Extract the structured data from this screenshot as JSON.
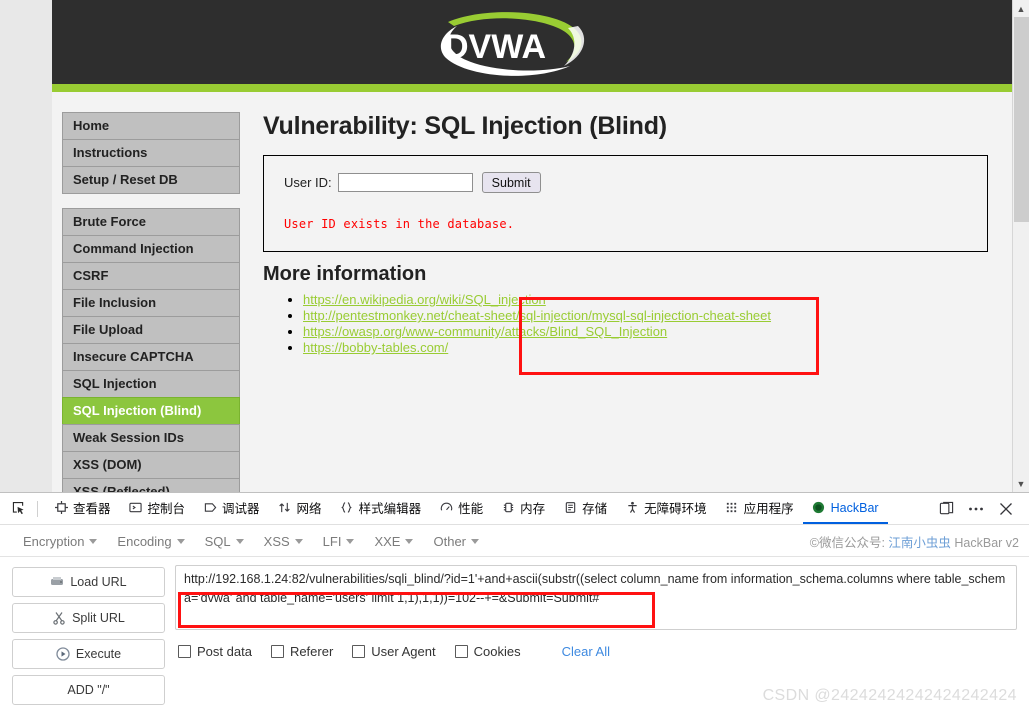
{
  "browser": {
    "scrollbar": {
      "up_icon": "chevron-up-icon",
      "down_icon": "chevron-down-icon"
    }
  },
  "dvwa": {
    "logo_text": "DVWA",
    "page_title": "Vulnerability: SQL Injection (Blind)",
    "sidebar": {
      "group1": [
        {
          "label": "Home",
          "active": false
        },
        {
          "label": "Instructions",
          "active": false
        },
        {
          "label": "Setup / Reset DB",
          "active": false
        }
      ],
      "group2": [
        {
          "label": "Brute Force",
          "active": false
        },
        {
          "label": "Command Injection",
          "active": false
        },
        {
          "label": "CSRF",
          "active": false
        },
        {
          "label": "File Inclusion",
          "active": false
        },
        {
          "label": "File Upload",
          "active": false
        },
        {
          "label": "Insecure CAPTCHA",
          "active": false
        },
        {
          "label": "SQL Injection",
          "active": false
        },
        {
          "label": "SQL Injection (Blind)",
          "active": true
        },
        {
          "label": "Weak Session IDs",
          "active": false
        },
        {
          "label": "XSS (DOM)",
          "active": false
        },
        {
          "label": "XSS (Reflected)",
          "active": false
        }
      ]
    },
    "form": {
      "user_id_label": "User ID:",
      "user_id_value": "",
      "user_id_placeholder": "",
      "submit_label": "Submit"
    },
    "result_message": "User ID exists in the database.",
    "more_information": {
      "heading": "More information",
      "links": [
        "https://en.wikipedia.org/wiki/SQL_injection",
        "http://pentestmonkey.net/cheat-sheet/sql-injection/mysql-sql-injection-cheat-sheet",
        "https://owasp.org/www-community/attacks/Blind_SQL_Injection",
        "https://bobby-tables.com/"
      ]
    }
  },
  "devtools": {
    "picker_icon": "element-picker-icon",
    "tabs": [
      {
        "label": "查看器",
        "icon": "inspector-icon",
        "active": false
      },
      {
        "label": "控制台",
        "icon": "console-icon",
        "active": false
      },
      {
        "label": "调试器",
        "icon": "debugger-icon",
        "active": false
      },
      {
        "label": "网络",
        "icon": "network-icon",
        "active": false
      },
      {
        "label": "样式编辑器",
        "icon": "style-editor-icon",
        "active": false
      },
      {
        "label": "性能",
        "icon": "performance-icon",
        "active": false
      },
      {
        "label": "内存",
        "icon": "memory-icon",
        "active": false
      },
      {
        "label": "存储",
        "icon": "storage-icon",
        "active": false
      },
      {
        "label": "无障碍环境",
        "icon": "accessibility-icon",
        "active": false
      },
      {
        "label": "应用程序",
        "icon": "application-icon",
        "active": false
      },
      {
        "label": "HackBar",
        "icon": "hackbar-icon",
        "active": true
      }
    ],
    "right_buttons": [
      {
        "name": "dock-toggle-icon",
        "glyph": "dock"
      },
      {
        "name": "more-options-icon",
        "glyph": "dots"
      },
      {
        "name": "close-devtools-icon",
        "glyph": "close"
      }
    ],
    "active_tab_color": "#0060df"
  },
  "hackbar": {
    "menu": [
      {
        "label": "Encryption"
      },
      {
        "label": "Encoding"
      },
      {
        "label": "SQL"
      },
      {
        "label": "XSS"
      },
      {
        "label": "LFI"
      },
      {
        "label": "XXE"
      },
      {
        "label": "Other"
      }
    ],
    "credit_prefix": "©微信公众号: ",
    "credit_name": "江南小虫虫",
    "credit_suffix": " HackBar v2",
    "buttons": [
      {
        "label": "Load URL",
        "icon": "load-url-icon"
      },
      {
        "label": "Split URL",
        "icon": "scissors-icon"
      },
      {
        "label": "Execute",
        "icon": "play-icon"
      },
      {
        "label": "ADD \"/\"",
        "icon": "none"
      }
    ],
    "url_value": "http://192.168.1.24:82/vulnerabilities/sqli_blind/?id=1'+and+ascii(substr((select column_name from information_schema.columns where table_schema='dvwa' and table_name='users' limit 1,1),1,1))=102--+=&Submit=Submit#",
    "checkboxes": [
      {
        "label": "Post data",
        "checked": false
      },
      {
        "label": "Referer",
        "checked": false
      },
      {
        "label": "User Agent",
        "checked": false
      },
      {
        "label": "Cookies",
        "checked": false
      }
    ],
    "clear_all_label": "Clear All"
  },
  "watermark": "CSDN @24242424242424242424"
}
